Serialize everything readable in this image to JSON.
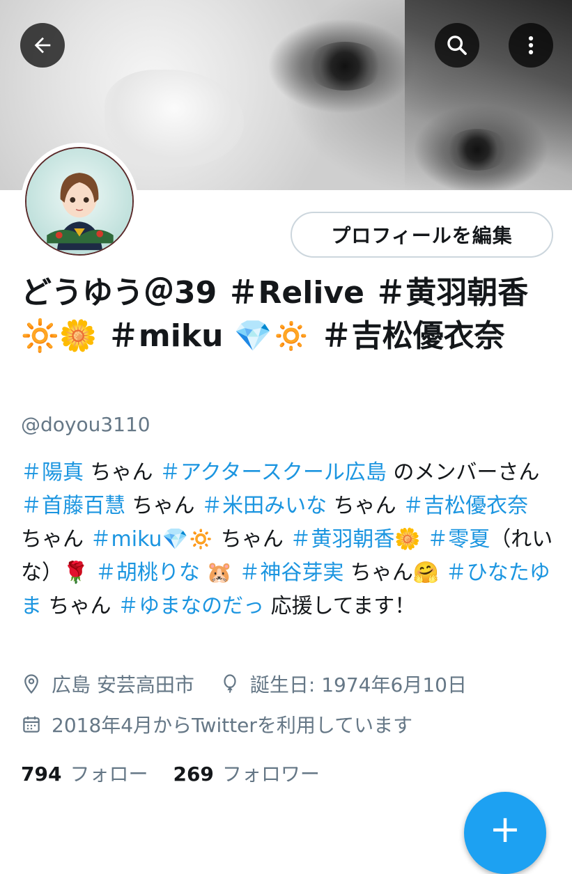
{
  "header": {
    "back_icon": "arrow-left-icon",
    "search_icon": "search-icon",
    "more_icon": "more-vertical-icon"
  },
  "profile": {
    "edit_button": "プロフィールを編集",
    "display_name": "どうゆう＠39 ＃Relive ＃黄羽朝香🔆🌼 ＃miku 💎🔅 ＃吉松優衣奈",
    "handle": "@doyou3110",
    "bio_segments": [
      {
        "text": "＃陽真",
        "tag": true
      },
      {
        "text": " ちゃん ",
        "tag": false
      },
      {
        "text": "＃アクタースクール広島",
        "tag": true
      },
      {
        "text": " のメンバーさん ",
        "tag": false
      },
      {
        "text": "＃首藤百慧",
        "tag": true
      },
      {
        "text": " ちゃん ",
        "tag": false
      },
      {
        "text": "＃米田みいな",
        "tag": true
      },
      {
        "text": " ちゃん ",
        "tag": false
      },
      {
        "text": "＃吉松優衣奈",
        "tag": true
      },
      {
        "text": " ちゃん ",
        "tag": false
      },
      {
        "text": "＃miku💎🔅",
        "tag": true
      },
      {
        "text": " ちゃん ",
        "tag": false
      },
      {
        "text": "＃黄羽朝香🌼",
        "tag": true
      },
      {
        "text": " ",
        "tag": false
      },
      {
        "text": "＃零夏",
        "tag": true
      },
      {
        "text": "（れいな）🌹 ",
        "tag": false
      },
      {
        "text": "＃胡桃りな",
        "tag": true
      },
      {
        "text": " 🐹 ",
        "tag": false
      },
      {
        "text": "＃神谷芽実",
        "tag": true
      },
      {
        "text": " ちゃん🤗 ",
        "tag": false
      },
      {
        "text": "＃ひなたゆま",
        "tag": true
      },
      {
        "text": " ちゃん ",
        "tag": false
      },
      {
        "text": "＃ゆまなのだっ",
        "tag": true
      },
      {
        "text": " 応援してます！",
        "tag": false
      }
    ],
    "location": "広島 安芸高田市",
    "birthday": "誕生日: 1974年6月10日",
    "joined": "2018年4月からTwitterを利用しています",
    "following_count": "794",
    "following_label": "フォロー",
    "followers_count": "269",
    "followers_label": "フォロワー"
  },
  "fab": {
    "label": "+",
    "icon": "compose-plus-icon"
  },
  "colors": {
    "link": "#1b95e0",
    "muted": "#657786",
    "fab": "#1da1f2"
  }
}
